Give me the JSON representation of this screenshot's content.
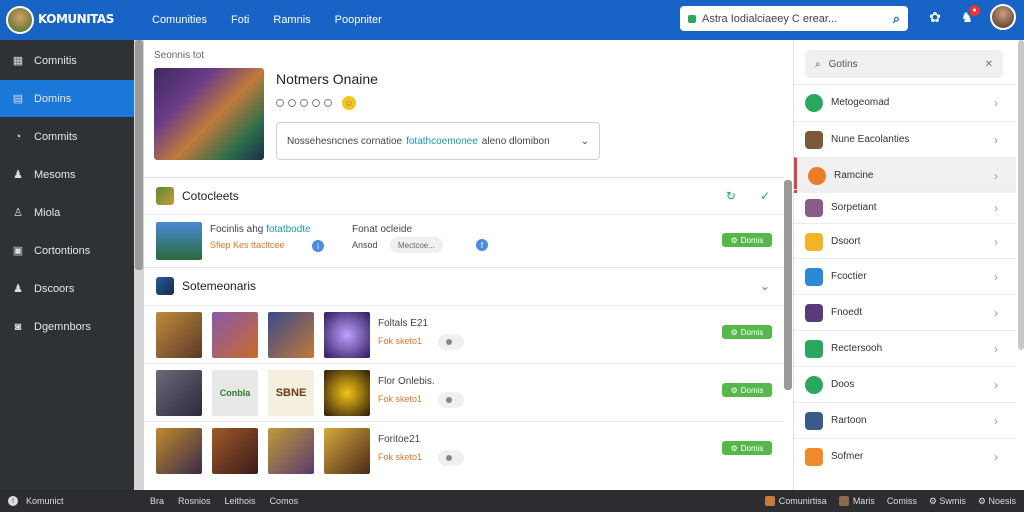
{
  "header": {
    "app_title": "KOMUNITAS",
    "app_subtitle": "",
    "nav": [
      "Comunities",
      "Foti",
      "Ramnis",
      "Poopniter"
    ],
    "search": {
      "value": "Astra Iodialciaeey C erear..."
    }
  },
  "sidebar": {
    "items": [
      {
        "label": "Comnitis",
        "icon": "grid-icon",
        "active": false
      },
      {
        "label": "Domins",
        "icon": "list-icon",
        "active": true
      },
      {
        "label": "Commits",
        "icon": "chat-icon",
        "active": false
      },
      {
        "label": "Mesoms",
        "icon": "person-icon",
        "active": false
      },
      {
        "label": "Miola",
        "icon": "user-icon",
        "active": false
      },
      {
        "label": "Cortontions",
        "icon": "folder-icon",
        "active": false
      },
      {
        "label": "Dscoors",
        "icon": "people-icon",
        "active": false
      },
      {
        "label": "Dgemnbors",
        "icon": "box-icon",
        "active": false
      }
    ]
  },
  "main": {
    "breadcrumb": "Seonnis tot",
    "hero": {
      "name": "Notmers Onaine",
      "select_text": "Nossehesncnes cornatioe",
      "select_highlight": "fotathcoemonee",
      "select_rest": "aleno dlomibon"
    },
    "section1": {
      "title": "Cotocleets",
      "row": {
        "title": "Focinlis ahg",
        "title_link": "fotatbodte",
        "sub": "Sfiep Kes ttacltcee",
        "col2_title": "Fonat ocleide",
        "col2_sub": "Ansod",
        "pill": "Mectcoe...",
        "button": "Domis"
      }
    },
    "section2": {
      "title": "Sotemeonaris",
      "rows": [
        {
          "title": "Foltals E21",
          "sub": "Fok sketo1",
          "pill": "",
          "button": "Domis"
        },
        {
          "title": "Flor Onlebis.",
          "sub": "Fok sketo1",
          "pill": "",
          "button": "Domis"
        },
        {
          "title": "Foritoe21",
          "sub": "Fok sketo1",
          "pill": "",
          "button": "Domis"
        }
      ],
      "tile_text": "Conbla",
      "tile_text2": "SBNE"
    }
  },
  "right_panel": {
    "search_placeholder": "Gotins",
    "items": [
      {
        "label": "Metogeomad",
        "icon": "whatsapp-icon",
        "color": "#2aa860"
      },
      {
        "label": "Nune Eacolanties",
        "icon": "game-icon",
        "color": "#7a5a3a"
      },
      {
        "label": "Ramcine",
        "icon": "orange-circle-icon",
        "color": "#f07a2a",
        "selected": true
      },
      {
        "label": "Sorpetiant",
        "icon": "char-icon",
        "color": "#8a5a8a"
      },
      {
        "label": "Dsoort",
        "icon": "chat-bubble-icon",
        "color": "#f5b32a"
      },
      {
        "label": "Fcoctier",
        "icon": "shield-icon",
        "color": "#2a8ad8"
      },
      {
        "label": "Fnoedt",
        "icon": "game-icon",
        "color": "#5a3a7a"
      },
      {
        "label": "Rectersooh",
        "icon": "check-shield-icon",
        "color": "#2aa860"
      },
      {
        "label": "Doos",
        "icon": "green-circle-icon",
        "color": "#2aa860"
      },
      {
        "label": "Rartoon",
        "icon": "char-icon",
        "color": "#3a5a8a"
      },
      {
        "label": "Sofmer",
        "icon": "flame-icon",
        "color": "#f08a2a"
      }
    ]
  },
  "bottom": {
    "left": "Komunict",
    "mid": [
      "Bra",
      "Rosnios",
      "Leithois",
      "Comos"
    ],
    "right": [
      "Comunirtisa",
      "Maris",
      "Comiss",
      "Swmis",
      "Noesis"
    ]
  },
  "colors": {
    "accent": "#1763c6",
    "active": "#1a78d8",
    "sidebar": "#2e3136",
    "button": "#56b84a"
  }
}
